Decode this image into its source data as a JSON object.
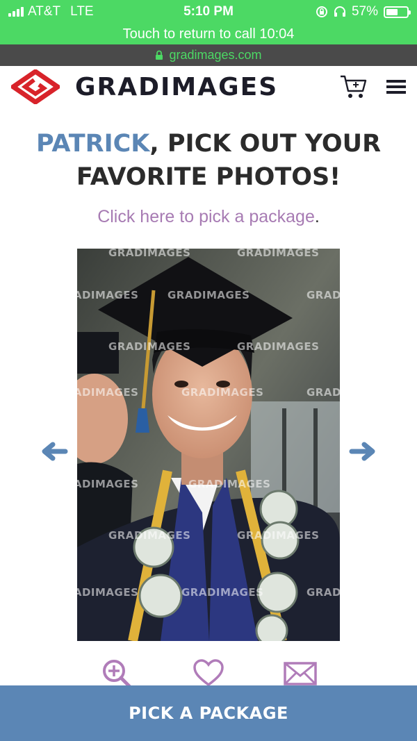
{
  "status_bar": {
    "carrier": "AT&T",
    "network": "LTE",
    "time": "5:10 PM",
    "battery": "57%",
    "battery_level": 0.57
  },
  "call_banner": {
    "text": "Touch to return to call 10:04"
  },
  "url_bar": {
    "url": "gradimages.com",
    "lock_icon": "lock-icon"
  },
  "header": {
    "brand": "GRADIMAGES",
    "cart_icon": "cart-icon",
    "menu_icon": "hamburger-menu-icon"
  },
  "headline": {
    "name": "PATRICK",
    "rest": ", PICK OUT YOUR FAVORITE PHOTOS!"
  },
  "package_prompt": {
    "link_text": "Click here to pick a package",
    "suffix": "."
  },
  "photo": {
    "alt": "Graduate smiling in cap and gown with gold cords and money leis",
    "watermark": "GRADIMAGES"
  },
  "nav": {
    "prev_icon": "arrow-left-icon",
    "next_icon": "arrow-right-icon"
  },
  "tools": {
    "zoom_icon": "zoom-in-icon",
    "favorite_icon": "heart-icon",
    "email_icon": "envelope-icon"
  },
  "cta": {
    "label": "PICK A PACKAGE"
  },
  "colors": {
    "banner_green": "#4cd964",
    "accent_blue": "#5b86b5",
    "link_purple": "#a77bb3",
    "logo_red": "#d8232a"
  }
}
